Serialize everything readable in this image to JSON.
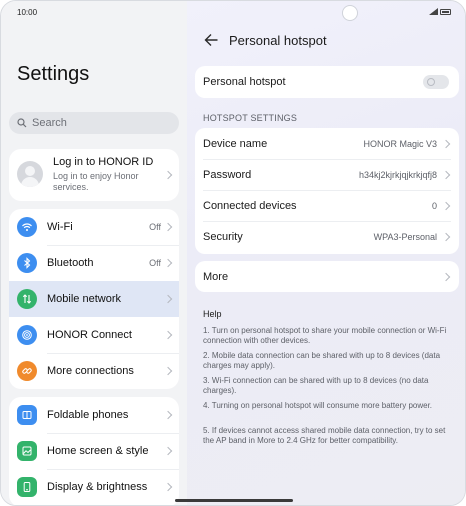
{
  "status_bar": {
    "time": "10:00"
  },
  "left": {
    "title": "Settings",
    "search": {
      "placeholder": "Search"
    },
    "login": {
      "title": "Log in to HONOR ID",
      "subtitle": "Log in to enjoy Honor services."
    },
    "group1": [
      {
        "label": "Wi-Fi",
        "value": "Off",
        "icon": "wifi-icon",
        "color": "#3d8ef0"
      },
      {
        "label": "Bluetooth",
        "value": "Off",
        "icon": "bluetooth-icon",
        "color": "#3d8ef0"
      },
      {
        "label": "Mobile network",
        "value": "",
        "icon": "mobile-network-icon",
        "color": "#33b36b",
        "active": true
      },
      {
        "label": "HONOR Connect",
        "value": "",
        "icon": "honor-connect-icon",
        "color": "#3d8ef0"
      },
      {
        "label": "More connections",
        "value": "",
        "icon": "link-icon",
        "color": "#f08a2c"
      }
    ],
    "group2": [
      {
        "label": "Foldable phones",
        "icon": "foldable-icon",
        "color": "#3d8ef0"
      },
      {
        "label": "Home screen & style",
        "icon": "home-screen-icon",
        "color": "#33b36b"
      },
      {
        "label": "Display & brightness",
        "icon": "display-icon",
        "color": "#33b36b"
      }
    ]
  },
  "right": {
    "title": "Personal hotspot",
    "hotspot_label": "Personal hotspot",
    "hotspot_enabled": false,
    "section_header": "HOTSPOT SETTINGS",
    "settings": [
      {
        "label": "Device name",
        "value": "HONOR Magic V3"
      },
      {
        "label": "Password",
        "value": "h34kj2kjrkjqjkrkjqfj8"
      },
      {
        "label": "Connected devices",
        "value": "0"
      },
      {
        "label": "Security",
        "value": "WPA3-Personal"
      }
    ],
    "more_label": "More",
    "help_title": "Help",
    "help_items": [
      "1. Turn on personal hotspot to share your mobile connection or Wi-Fi connection with other devices.",
      "2. Mobile data connection can be shared with up to 8 devices (data charges may apply).",
      "3. Wi-Fi connection can be shared with up to 8 devices (no data charges).",
      "4. Turning on personal hotspot will consume more battery power.",
      "5. If devices cannot access shared mobile data connection, try to set the AP band in More to 2.4 GHz for better compatibility."
    ]
  }
}
